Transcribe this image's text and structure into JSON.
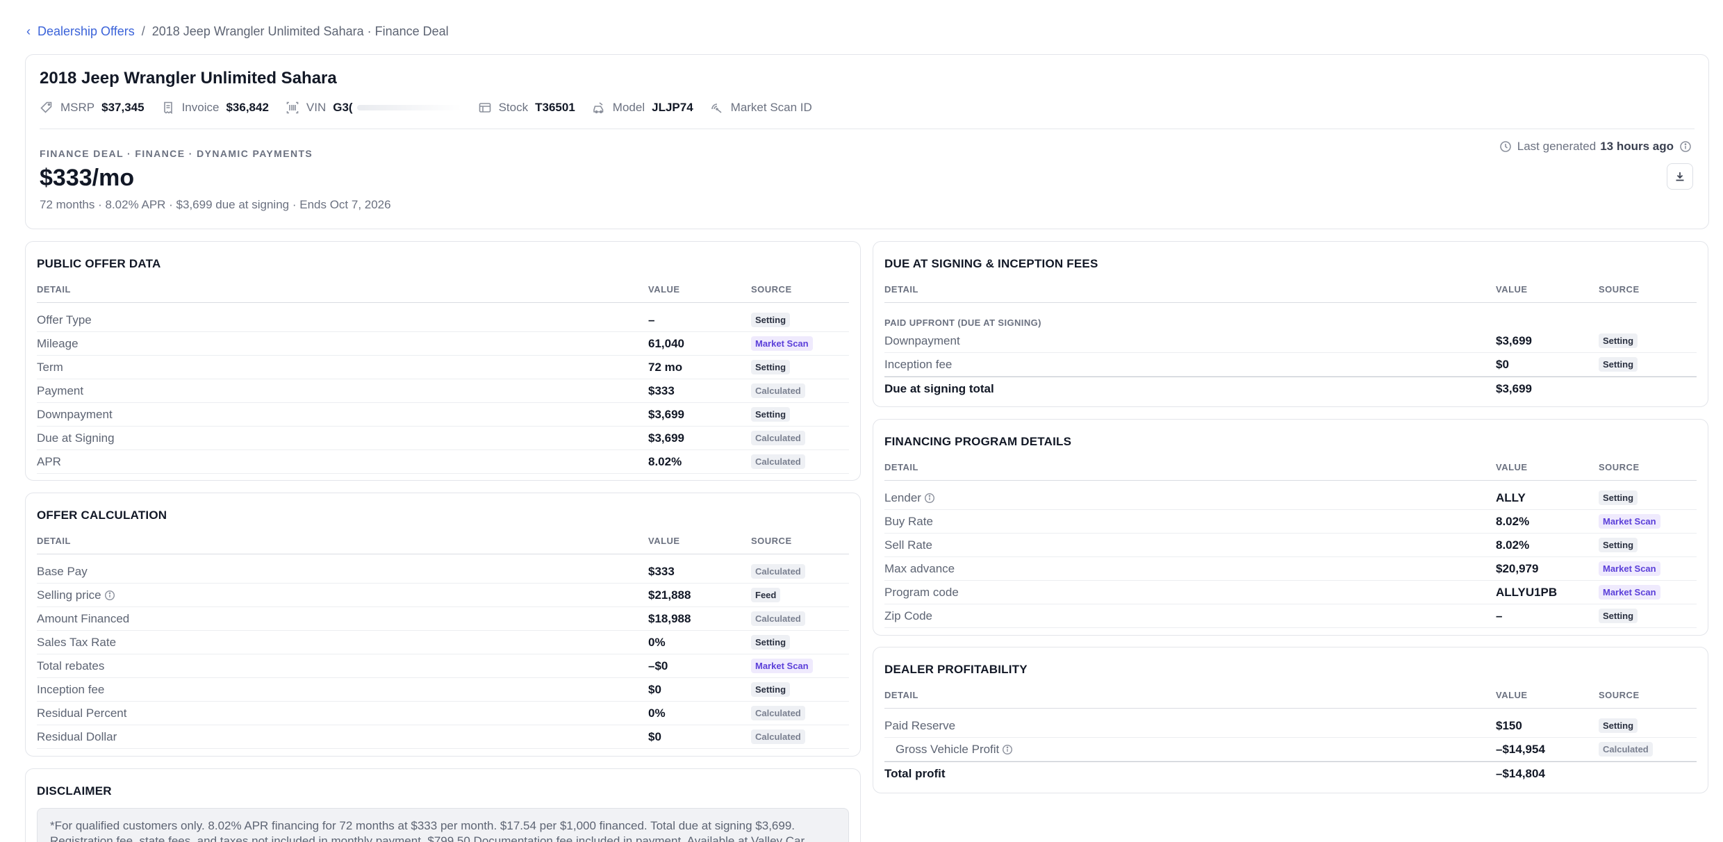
{
  "breadcrumb": {
    "back_icon": "chevron-left-icon",
    "parent": "Dealership Offers",
    "separator": "/",
    "current": "2018 Jeep Wrangler Unlimited Sahara · Finance Deal"
  },
  "vehicle": {
    "title": "2018 Jeep Wrangler Unlimited Sahara",
    "specs": {
      "msrp_label": "MSRP",
      "msrp_value": "$37,345",
      "invoice_label": "Invoice",
      "invoice_value": "$36,842",
      "vin_label": "VIN",
      "vin_value": "G3(",
      "stock_label": "Stock",
      "stock_value": "T36501",
      "model_label": "Model",
      "model_value": "JLJP74",
      "marketscan_label": "Market Scan ID"
    }
  },
  "deal": {
    "eyebrow": "FINANCE DEAL · FINANCE · DYNAMIC PAYMENTS",
    "price": "$333/mo",
    "summary": "72 months · 8.02% APR · $3,699 due at signing · Ends Oct 7, 2026",
    "last_generated_label": "Last generated",
    "last_generated_value": "13 hours ago"
  },
  "columns": {
    "detail": "DETAIL",
    "value": "VALUE",
    "source": "SOURCE"
  },
  "public_offer": {
    "title": "PUBLIC OFFER DATA",
    "rows": [
      {
        "detail": "Offer Type",
        "value": "–",
        "source": "Setting"
      },
      {
        "detail": "Mileage",
        "value": "61,040",
        "source": "Market Scan"
      },
      {
        "detail": "Term",
        "value": "72 mo",
        "source": "Setting"
      },
      {
        "detail": "Payment",
        "value": "$333",
        "source": "Calculated"
      },
      {
        "detail": "Downpayment",
        "value": "$3,699",
        "source": "Setting"
      },
      {
        "detail": "Due at Signing",
        "value": "$3,699",
        "source": "Calculated"
      },
      {
        "detail": "APR",
        "value": "8.02%",
        "source": "Calculated"
      }
    ]
  },
  "offer_calc": {
    "title": "OFFER CALCULATION",
    "rows": [
      {
        "detail": "Base Pay",
        "value": "$333",
        "source": "Calculated"
      },
      {
        "detail": "Selling price",
        "value": "$21,888",
        "source": "Feed"
      },
      {
        "detail": "Amount Financed",
        "value": "$18,988",
        "source": "Calculated"
      },
      {
        "detail": "Sales Tax Rate",
        "value": "0%",
        "source": "Setting"
      },
      {
        "detail": "Total rebates",
        "value": "–$0",
        "source": "Market Scan"
      },
      {
        "detail": "Inception fee",
        "value": "$0",
        "source": "Setting"
      },
      {
        "detail": "Residual Percent",
        "value": "0%",
        "source": "Calculated"
      },
      {
        "detail": "Residual Dollar",
        "value": "$0",
        "source": "Calculated"
      }
    ]
  },
  "disclaimer": {
    "title": "DISCLAIMER",
    "text": "*For qualified customers only. 8.02% APR financing for 72 months at $333 per month. $17.54 per $1,000 financed. Total due at signing $3,699. Registration fee, state fees, and taxes not included in monthly payment. $799.50 Documentation fee included in payment. Available at Valley Car"
  },
  "due_signing": {
    "title": "DUE AT SIGNING & INCEPTION FEES",
    "subhead": "PAID UPFRONT (DUE AT SIGNING)",
    "rows": [
      {
        "detail": "Downpayment",
        "value": "$3,699",
        "source": "Setting"
      },
      {
        "detail": "Inception fee",
        "value": "$0",
        "source": "Setting"
      }
    ],
    "total": {
      "detail": "Due at signing total",
      "value": "$3,699"
    }
  },
  "financing": {
    "title": "FINANCING PROGRAM DETAILS",
    "rows": [
      {
        "detail": "Lender",
        "value": "ALLY",
        "source": "Setting"
      },
      {
        "detail": "Buy Rate",
        "value": "8.02%",
        "source": "Market Scan"
      },
      {
        "detail": "Sell Rate",
        "value": "8.02%",
        "source": "Setting"
      },
      {
        "detail": "Max advance",
        "value": "$20,979",
        "source": "Market Scan"
      },
      {
        "detail": "Program code",
        "value": "ALLYU1PB",
        "source": "Market Scan"
      },
      {
        "detail": "Zip Code",
        "value": "–",
        "source": "Setting"
      }
    ]
  },
  "profitability": {
    "title": "DEALER PROFITABILITY",
    "rows": [
      {
        "detail": "Paid Reserve",
        "value": "$150",
        "source": "Setting"
      },
      {
        "detail": "Gross Vehicle Profit",
        "value": "–$14,954",
        "source": "Calculated"
      }
    ],
    "total": {
      "detail": "Total profit",
      "value": "–$14,804"
    }
  },
  "colors": {
    "link": "#3b63d9",
    "market_scan_badge_text": "#5b3fd9",
    "market_scan_badge_bg": "#efeafd",
    "badge_bg": "#eef0f4"
  }
}
